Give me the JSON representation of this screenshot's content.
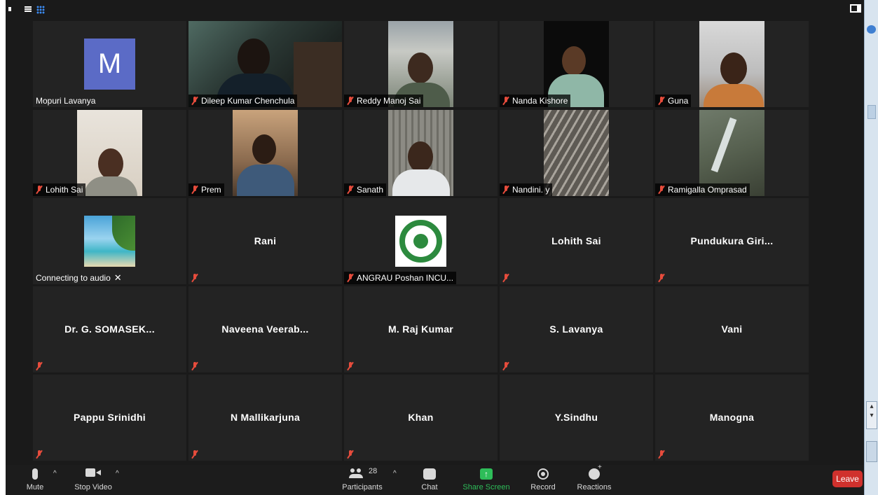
{
  "gallery": {
    "tiles": [
      {
        "name": "Mopuri Lavanya",
        "label": "Mopuri Lavanya",
        "muted": false,
        "avatar_letter": "M",
        "avatar_color": "#5b6bc6"
      },
      {
        "name": "Dileep Kumar Chenchula",
        "label": "Dileep Kumar Chenchula",
        "muted": true
      },
      {
        "name": "Reddy Manoj Sai",
        "label": "Reddy Manoj Sai",
        "muted": true
      },
      {
        "name": "Nanda Kishore",
        "label": "Nanda Kishore",
        "muted": true
      },
      {
        "name": "Guna",
        "label": "Guna",
        "muted": true
      },
      {
        "name": "Lohith Sai",
        "label": "Lohith Sai",
        "muted": true
      },
      {
        "name": "Prem",
        "label": "Prem",
        "muted": true
      },
      {
        "name": "Sanath",
        "label": "Sanath",
        "muted": true
      },
      {
        "name": "Nandini. y",
        "label": "Nandini. y",
        "muted": true
      },
      {
        "name": "Ramigalla Omprasad",
        "label": "Ramigalla Omprasad",
        "muted": true
      },
      {
        "name": "Connecting to audio",
        "label": "Connecting to audio",
        "muted": false
      },
      {
        "name": "Rani",
        "center_name": "Rani",
        "muted": true
      },
      {
        "name": "ANGRAU Poshan INCU...",
        "label": "ANGRAU Poshan INCU...",
        "muted": true
      },
      {
        "name": "Lohith Sai",
        "center_name": "Lohith Sai",
        "muted": true
      },
      {
        "name": "Pundukura Giri...",
        "center_name": "Pundukura  Giri...",
        "muted": true
      },
      {
        "name": "Dr. G. SOMASEK...",
        "center_name": "Dr. G. SOMASEK...",
        "muted": true
      },
      {
        "name": "Naveena Veerab...",
        "center_name": "Naveena  Veerab...",
        "muted": true
      },
      {
        "name": "M. Raj Kumar",
        "center_name": "M. Raj Kumar",
        "muted": true
      },
      {
        "name": "S. Lavanya",
        "center_name": "S. Lavanya",
        "muted": true
      },
      {
        "name": "Vani",
        "center_name": "Vani",
        "muted": false
      },
      {
        "name": "Pappu Srinidhi",
        "center_name": "Pappu Srinidhi",
        "muted": true
      },
      {
        "name": "N Mallikarjuna",
        "center_name": "N Mallikarjuna",
        "muted": true
      },
      {
        "name": "Khan",
        "center_name": "Khan",
        "muted": true
      },
      {
        "name": "Y.Sindhu",
        "center_name": "Y.Sindhu",
        "muted": false
      },
      {
        "name": "Manogna",
        "center_name": "Manogna",
        "muted": true
      }
    ]
  },
  "toolbar": {
    "mute_label": "Mute",
    "stop_video_label": "Stop Video",
    "participants_label": "Participants",
    "participants_count": "28",
    "chat_label": "Chat",
    "share_screen_label": "Share Screen",
    "record_label": "Record",
    "reactions_label": "Reactions",
    "leave_label": "Leave"
  },
  "icons": {
    "muted": "mic-muted-icon",
    "mic": "microphone-icon",
    "video": "video-camera-icon",
    "participants": "participants-icon",
    "chat": "chat-bubble-icon",
    "share": "share-screen-icon",
    "record": "record-icon",
    "reactions": "reactions-icon",
    "close": "close-icon"
  },
  "colors": {
    "background": "#1a1a1a",
    "tile": "#232323",
    "share_green": "#2ebd59",
    "leave_red": "#d0312d",
    "muted_red": "#e74c3c",
    "avatar_blue": "#5b6bc6"
  }
}
